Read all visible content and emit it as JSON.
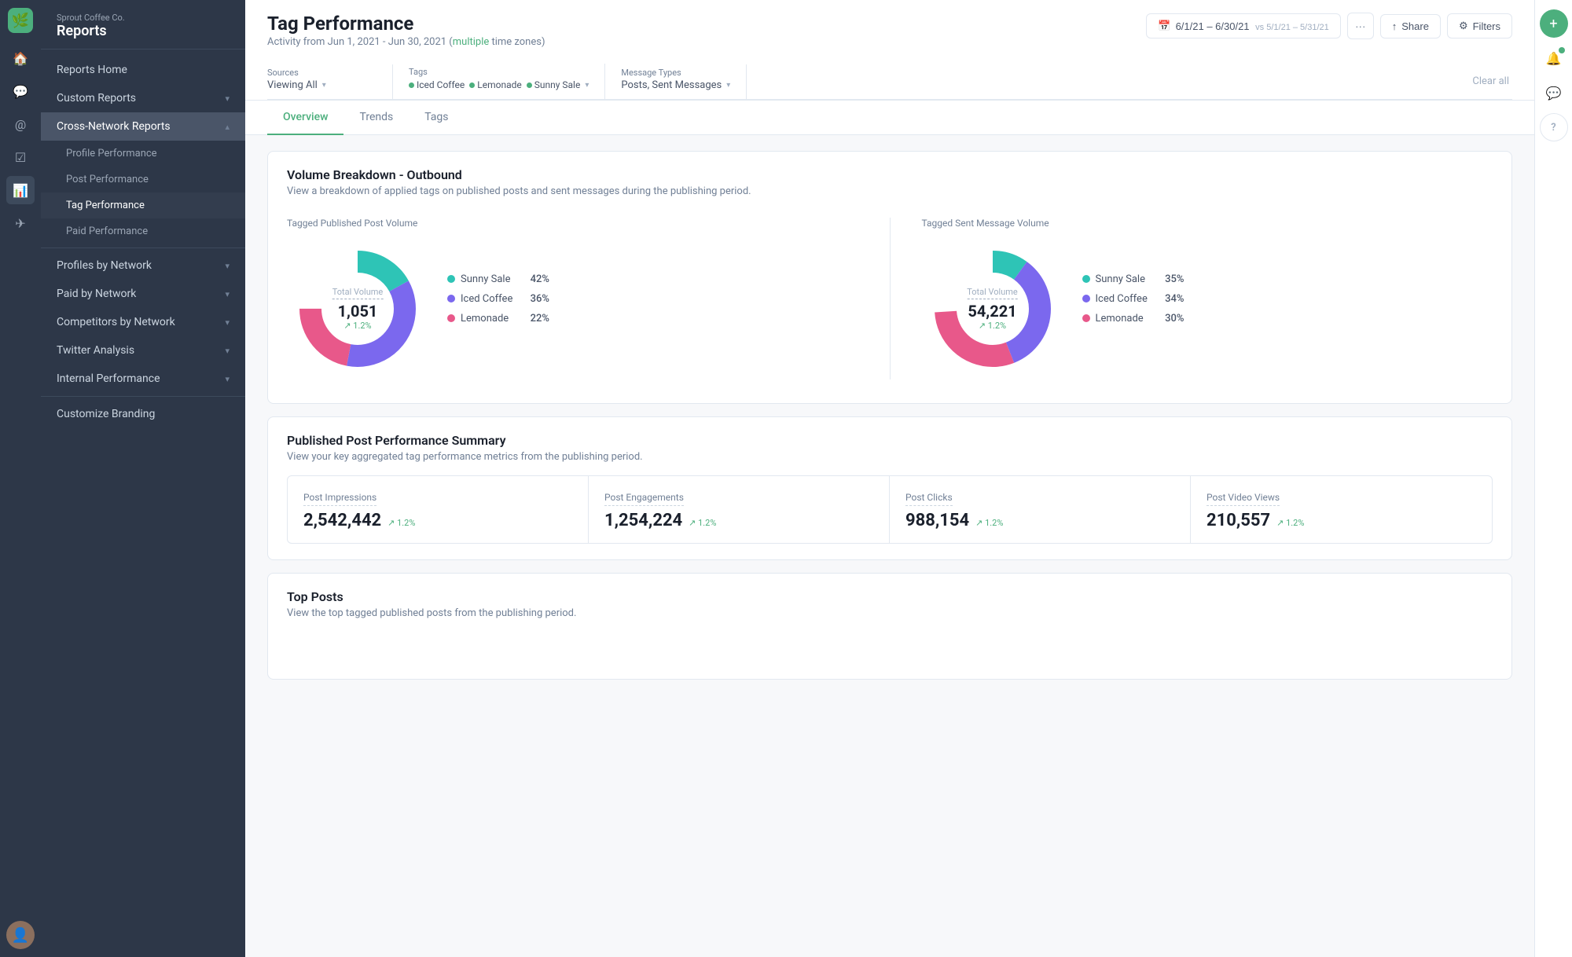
{
  "app": {
    "company": "Sprout Coffee Co.",
    "section": "Reports"
  },
  "sidebar": {
    "reports_home": "Reports Home",
    "custom_reports": "Custom Reports",
    "cross_network": "Cross-Network Reports",
    "nav_items": [
      {
        "id": "profile-performance",
        "label": "Profile Performance",
        "active": false
      },
      {
        "id": "post-performance",
        "label": "Post Performance",
        "active": false
      },
      {
        "id": "tag-performance",
        "label": "Tag Performance",
        "active": true
      },
      {
        "id": "paid-performance",
        "label": "Paid Performance",
        "active": false
      }
    ],
    "network_sections": [
      {
        "id": "profiles-by-network",
        "label": "Profiles by Network"
      },
      {
        "id": "paid-by-network",
        "label": "Paid by Network"
      },
      {
        "id": "competitors-by-network",
        "label": "Competitors by Network"
      },
      {
        "id": "twitter-analysis",
        "label": "Twitter Analysis"
      },
      {
        "id": "internal-performance",
        "label": "Internal Performance"
      }
    ],
    "customize_branding": "Customize Branding"
  },
  "page": {
    "title": "Tag Performance",
    "subtitle_prefix": "Activity from Jun 1, 2021 - Jun 30, 2021 (",
    "subtitle_link": "multiple",
    "subtitle_suffix": " time zones)"
  },
  "header_actions": {
    "date_range": "6/1/21 – 6/30/21",
    "date_vs": "vs 5/1/21 – 5/31/21",
    "more_label": "···",
    "share_label": "Share",
    "filters_label": "Filters"
  },
  "filters": {
    "sources_label": "Sources",
    "sources_value": "Viewing All",
    "tags_label": "Tags",
    "tags": [
      {
        "name": "Iced Coffee",
        "color": "#4caf7d"
      },
      {
        "name": "Lemonade",
        "color": "#4caf7d"
      },
      {
        "name": "Sunny Sale",
        "color": "#4caf7d"
      }
    ],
    "message_types_label": "Message Types",
    "message_types_value": "Posts, Sent Messages",
    "clear_all": "Clear all"
  },
  "tabs": [
    {
      "id": "overview",
      "label": "Overview",
      "active": true
    },
    {
      "id": "trends",
      "label": "Trends",
      "active": false
    },
    {
      "id": "tags",
      "label": "Tags",
      "active": false
    }
  ],
  "volume_card": {
    "title": "Volume Breakdown - Outbound",
    "subtitle": "View a breakdown of applied tags on published posts and sent messages during the publishing period.",
    "left_chart": {
      "label": "Tagged Published Post Volume",
      "center_label": "Total Volume",
      "center_value": "1,051",
      "center_change": "↗ 1.2%",
      "segments": [
        {
          "name": "Sunny Sale",
          "pct": 42,
          "color": "#2ec4b6"
        },
        {
          "name": "Iced Coffee",
          "pct": 36,
          "color": "#7b68ee"
        },
        {
          "name": "Lemonade",
          "pct": 22,
          "color": "#e8588a"
        }
      ]
    },
    "right_chart": {
      "label": "Tagged Sent Message Volume",
      "center_label": "Total Volume",
      "center_value": "54,221",
      "center_change": "↗ 1.2%",
      "segments": [
        {
          "name": "Sunny Sale",
          "pct": 35,
          "color": "#2ec4b6"
        },
        {
          "name": "Iced Coffee",
          "pct": 34,
          "color": "#7b68ee"
        },
        {
          "name": "Lemonade",
          "pct": 30,
          "color": "#e8588a"
        }
      ]
    }
  },
  "performance_card": {
    "title": "Published Post Performance Summary",
    "subtitle": "View your key aggregated tag performance metrics from the publishing period.",
    "stats": [
      {
        "id": "post-impressions",
        "name": "Post Impressions",
        "value": "2,542,442",
        "change": "↗ 1.2%"
      },
      {
        "id": "post-engagements",
        "name": "Post Engagements",
        "value": "1,254,224",
        "change": "↗ 1.2%"
      },
      {
        "id": "post-clicks",
        "name": "Post Clicks",
        "value": "988,154",
        "change": "↗ 1.2%"
      },
      {
        "id": "post-video-views",
        "name": "Post Video Views",
        "value": "210,557",
        "change": "↗ 1.2%"
      }
    ]
  },
  "top_posts_card": {
    "title": "Top Posts",
    "subtitle": "View the top tagged published posts from the publishing period."
  },
  "icons": {
    "logo": "🌿",
    "home": "🏠",
    "compose": "+",
    "bell": "🔔",
    "chat": "💬",
    "help": "?",
    "calendar": "📅",
    "share": "↑",
    "filter": "⚙",
    "reports": "📊",
    "custom": "📋",
    "network": "🌐",
    "pin": "📌",
    "list": "☰",
    "send": "✈",
    "chart": "📈",
    "star": "★",
    "user": "👤"
  },
  "colors": {
    "green": "#4caf7d",
    "sidebar_bg": "#2d3748",
    "teal": "#2ec4b6",
    "purple": "#7b68ee",
    "pink": "#e8588a"
  }
}
